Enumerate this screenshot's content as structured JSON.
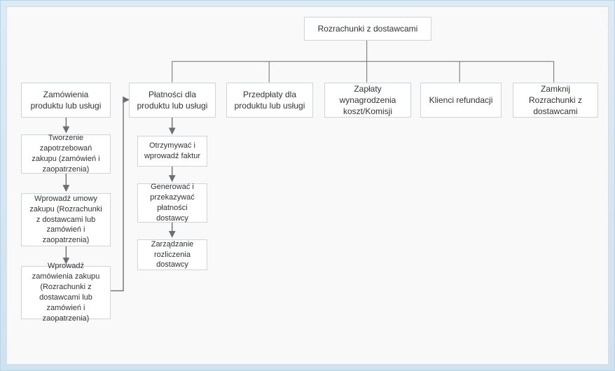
{
  "root": {
    "title": "Rozrachunki z dostawcami"
  },
  "columns": {
    "orders": {
      "title": "Zamówienia produktu lub usługi"
    },
    "payments": {
      "title": "Płatności dla produktu lub usługi"
    },
    "prepay": {
      "title": "Przedpłaty dla produktu lub usługi"
    },
    "wages": {
      "title": "Zapłaty wynagrodzenia koszt/Komisji"
    },
    "refunds": {
      "title": "Klienci refundacji"
    },
    "close": {
      "title": "Zamknij Rozrachunki z dostawcami"
    }
  },
  "ordersFlow": {
    "step1": "Tworzenie zapotrzebowań zakupu (zamówień i zaopatrzenia)",
    "step2": "Wprowadź umowy zakupu (Rozrachunki z dostawcami lub zamówień i zaopatrzenia)",
    "step3": "Wprowadź zamówienia zakupu (Rozrachunki z dostawcami lub zamówień i zaopatrzenia)"
  },
  "paymentsFlow": {
    "step1": "Otrzymywać i wprowadź faktur",
    "step2": "Generować i przekazywać płatności dostawcy",
    "step3": "Zarządzanie rozliczenia dostawcy"
  }
}
